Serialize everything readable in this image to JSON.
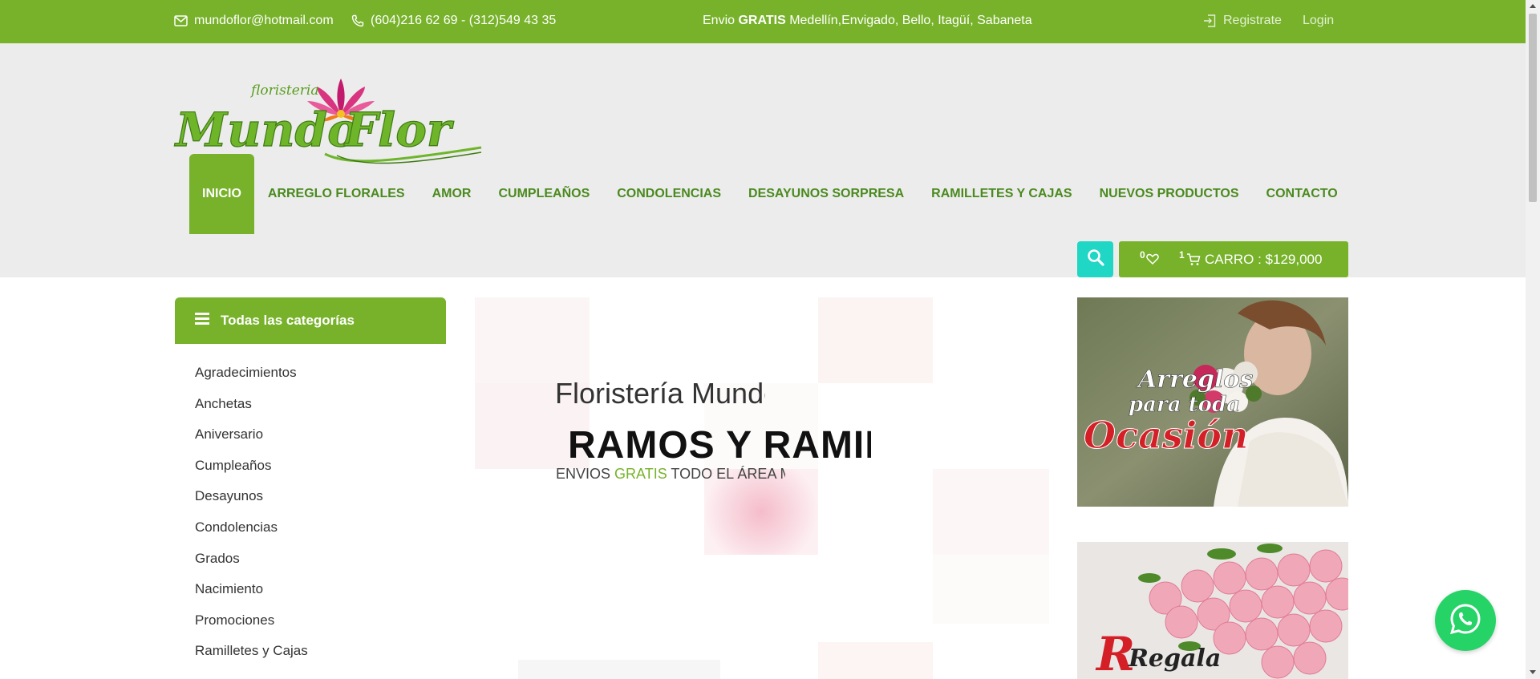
{
  "topbar": {
    "email": "mundoflor@hotmail.com",
    "phone": "(604)216 62 69 - (312)549 43 35",
    "shipping_prefix": "Envio",
    "shipping_bold": "GRATIS",
    "shipping_rest": "Medellín,Envigado, Bello, Itagüí, Sabaneta",
    "register_label": "Registrate",
    "login_label": "Login",
    "icons": [
      "envelope-icon",
      "phone-icon",
      "login-icon"
    ]
  },
  "logo": {
    "small_text": "floristeria",
    "word1": "Mundo",
    "word2": "Flor"
  },
  "nav": {
    "items": [
      {
        "label": "INICIO",
        "active": true
      },
      {
        "label": "ARREGLO FLORALES"
      },
      {
        "label": "AMOR"
      },
      {
        "label": "CUMPLEAÑOS"
      },
      {
        "label": "CONDOLENCIAS"
      },
      {
        "label": "DESAYUNOS SORPRESA"
      },
      {
        "label": "RAMILLETES Y CAJAS"
      },
      {
        "label": "NUEVOS PRODUCTOS"
      },
      {
        "label": "CONTACTO"
      }
    ]
  },
  "cart": {
    "wishlist_count": "0",
    "cart_count": "1",
    "label": "CARRO : $129,000"
  },
  "categories": {
    "title": "Todas las categorías",
    "items": [
      "Agradecimientos",
      "Anchetas",
      "Aniversario",
      "Cumpleaños",
      "Desayunos",
      "Condolencias",
      "Grados",
      "Nacimiento",
      "Promociones",
      "Ramilletes y Cajas"
    ]
  },
  "slider": {
    "title": "Floristería Mundo Flor",
    "headline": "RAMOS Y RAMILLETES",
    "sub_prefix": "ENVIOS",
    "sub_green": "GRATIS",
    "sub_rest": "TODO EL ÁREA METROPOLITANA"
  },
  "banners": {
    "banner1_line1": "Arreglos",
    "banner1_line2": "para toda",
    "banner1_line3": "Ocasión",
    "banner2_line1": "Regala",
    "banner2_line2": "R"
  },
  "colors": {
    "brand_green": "#77b22a",
    "nav_green": "#4a8a1e",
    "search_teal": "#20d6c5",
    "whatsapp_green": "#25d366",
    "header_bg": "#ececec"
  }
}
